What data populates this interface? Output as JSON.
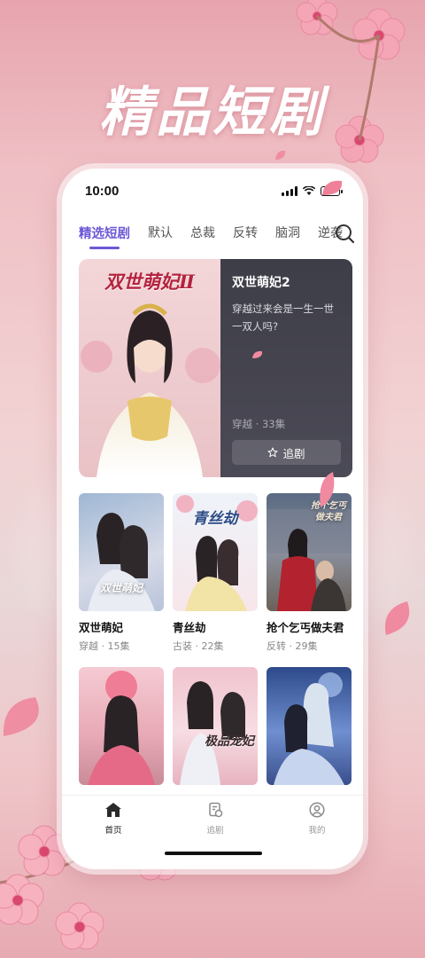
{
  "promo": {
    "headline": "精品短剧"
  },
  "status_bar": {
    "time": "10:00"
  },
  "tabs": [
    {
      "label": "精选短剧",
      "active": true
    },
    {
      "label": "默认",
      "active": false
    },
    {
      "label": "总裁",
      "active": false
    },
    {
      "label": "反转",
      "active": false
    },
    {
      "label": "脑洞",
      "active": false
    },
    {
      "label": "逆袭",
      "active": false
    }
  ],
  "featured": {
    "poster_caption": "双世萌妃Ⅱ",
    "title": "双世萌妃2",
    "description": "穿越过来会是一生一世一双人吗?",
    "meta": "穿越 · 33集",
    "follow_label": "追剧",
    "follow_icon": "star-icon"
  },
  "dramas": [
    {
      "title": "双世萌妃",
      "meta": "穿越 · 15集",
      "poster_caption": "双世萌妃"
    },
    {
      "title": "青丝劫",
      "meta": "古装 · 22集",
      "poster_caption": "青丝劫"
    },
    {
      "title": "抢个乞丐做夫君",
      "meta": "反转 · 29集",
      "poster_caption": "抢个乞丐做夫君"
    },
    {
      "title": "",
      "meta": "",
      "poster_caption": ""
    },
    {
      "title": "",
      "meta": "",
      "poster_caption": "极品宠妃"
    },
    {
      "title": "",
      "meta": "",
      "poster_caption": ""
    }
  ],
  "bottom_nav": [
    {
      "label": "首页",
      "icon": "home-icon",
      "active": true
    },
    {
      "label": "追剧",
      "icon": "follow-list-icon",
      "active": false
    },
    {
      "label": "我的",
      "icon": "profile-icon",
      "active": false
    }
  ],
  "colors": {
    "accent": "#6c58d6",
    "background_pink": "#efc0c5"
  }
}
